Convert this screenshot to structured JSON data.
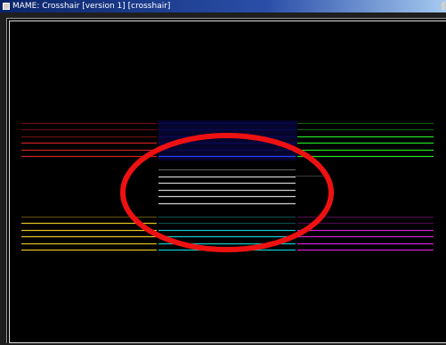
{
  "window": {
    "title": "MAME: Crosshair [version 1] [crosshair]",
    "background": "#000000"
  },
  "annotation": {
    "shape": "ellipse",
    "color": "#ee1111"
  },
  "palette_groups": [
    {
      "name": "red-lines",
      "color": "#d02020",
      "dim": "#6a1010",
      "count": 6,
      "bright_from": 4
    },
    {
      "name": "blue-lines",
      "color": "#2a3cff",
      "dim": "#0a0a55",
      "count": 6,
      "bright_from": 6
    },
    {
      "name": "green-lines",
      "color": "#22e022",
      "dim": "#0d5a0d",
      "count": 6,
      "bright_from": 3
    },
    {
      "name": "white-lines",
      "color": "#d0d0d0",
      "dim": "#5a5a5a",
      "count": 6,
      "bright_from": 2
    },
    {
      "name": "yellow-lines",
      "color": "#e0c020",
      "dim": "#5a4a0a",
      "count": 6,
      "bright_from": 2
    },
    {
      "name": "cyan-lines",
      "color": "#10c8c8",
      "dim": "#0a4a4a",
      "count": 6,
      "bright_from": 3
    },
    {
      "name": "magenta-lines",
      "color": "#d020d0",
      "dim": "#4a0a4a",
      "count": 6,
      "bright_from": 3
    }
  ]
}
